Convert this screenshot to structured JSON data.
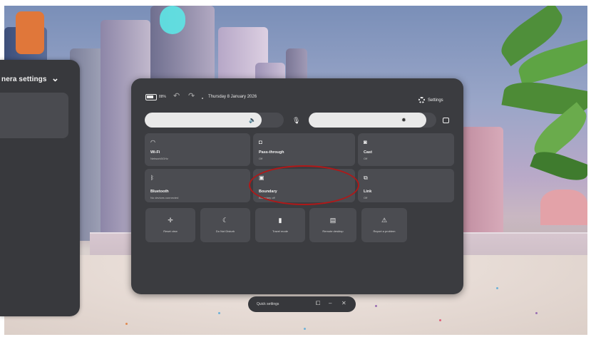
{
  "side_panel": {
    "title": "nera settings"
  },
  "topbar": {
    "battery_text": "88%",
    "datetime": "Thursday 8 January 2026",
    "settings_label": "Settings"
  },
  "tiles": [
    {
      "title": "Wi-Fi",
      "sub": "Network5GHz"
    },
    {
      "title": "Pass-through",
      "sub": "Off"
    },
    {
      "title": "Cast",
      "sub": "Off"
    },
    {
      "title": "Bluetooth",
      "sub": "No devices connected"
    },
    {
      "title": "Boundary",
      "sub": "Boundary off"
    },
    {
      "title": "Link",
      "sub": "Off"
    }
  ],
  "actions": [
    {
      "label": "Reset view"
    },
    {
      "label": "Do Not Disturb"
    },
    {
      "label": "Travel mode"
    },
    {
      "label": "Remote desktop"
    },
    {
      "label": "Report a problem"
    }
  ],
  "bottombar": {
    "label": "Quick settings"
  },
  "sliders": {
    "volume_level": 0.84,
    "brightness_level": 0.92
  },
  "colors": {
    "panel": "#3b3c40",
    "tile": "#4b4c51",
    "highlight": "#b01818"
  }
}
